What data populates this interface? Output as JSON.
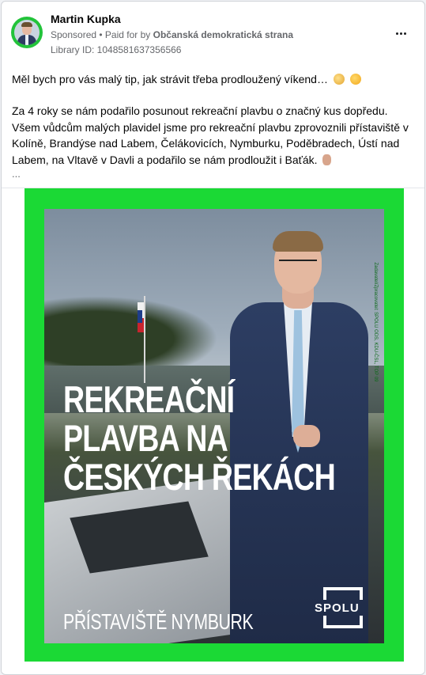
{
  "post": {
    "author": "Martin Kupka",
    "sponsored": "Sponsored",
    "paid_for_prefix": "• Paid for by",
    "payer": "Občanská demokratická strana",
    "library_id": "Library ID: 1048581637356566",
    "text_line1": "Měl bych pro vás malý tip, jak strávit třeba prodloužený víkend…",
    "text_para2": "Za 4 roky se nám podařilo posunout rekreační plavbu o značný kus dopředu. Všem vůdcům malých plavidel jsme pro rekreační plavbu zprovoznili přístaviště v Kolíně, Brandýse nad Labem, Čelákovicích, Nymburku, Poděbradech, Ústí nad Labem, na Vltavě v Davli a podařilo se nám prodloužit i Baťák.",
    "ellipsis": "..."
  },
  "icons": {
    "more": "more-horizontal-icon",
    "emoji1": "hugging-face-emoji",
    "emoji2": "winking-face-emoji",
    "emoji3": "thumbs-up-emoji"
  },
  "ad_image": {
    "headline": [
      "REKREAČNÍ",
      "PLAVBA NA",
      "ČESKÝCH ŘEKÁCH"
    ],
    "subline": "PŘÍSTAVIŠTĚ NYMBURK",
    "logo_text": "SPOLU",
    "vertical_text": "Zadavatel/Zpracovatel: SPOLU ODS, KDU-ČSL, TOP 09",
    "frame_color": "#1bd935"
  }
}
